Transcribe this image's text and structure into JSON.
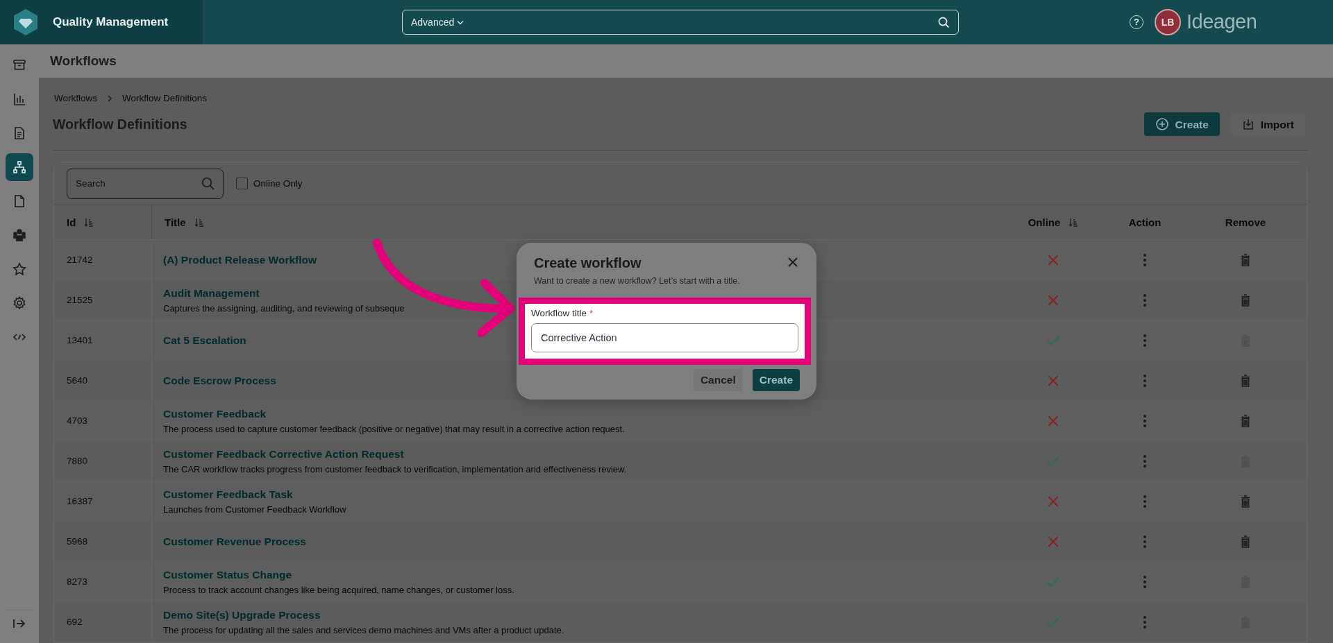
{
  "header": {
    "brand": "Quality Management",
    "search": {
      "scope": "Advanced"
    },
    "help": "?",
    "avatar": "LB",
    "logo": "Ideagen"
  },
  "sidebar": {
    "items": [
      {
        "selected": false
      },
      {
        "selected": false
      },
      {
        "selected": false
      },
      {
        "selected": true
      },
      {
        "selected": false
      },
      {
        "selected": false
      },
      {
        "selected": false
      },
      {
        "selected": false
      },
      {
        "selected": false
      }
    ]
  },
  "module_title": "Workflows",
  "breadcrumb": [
    "Workflows",
    "Workflow Definitions"
  ],
  "page_title": "Workflow Definitions",
  "actions": [
    {
      "label": "Create",
      "kind": "primary"
    },
    {
      "label": "Import",
      "kind": "secondary"
    }
  ],
  "filters": {
    "search": {
      "placeholder": "Search"
    },
    "online_only": {
      "label": "Online Only",
      "checked": false
    }
  },
  "table": {
    "columns": [
      {
        "label": "Id",
        "sortable": true
      },
      {
        "label": "Title",
        "sortable": true
      },
      {
        "label": "Online",
        "sortable": true
      },
      {
        "label": "Action",
        "sortable": false
      },
      {
        "label": "Remove",
        "sortable": false
      }
    ],
    "rows": [
      {
        "id": "21742",
        "title": "(A) Product Release Workflow",
        "online": false,
        "remove_disabled": false
      },
      {
        "id": "21525",
        "title": "Audit Management",
        "description": "Captures the assigning, auditing, and reviewing of subseque",
        "online": false,
        "remove_disabled": false
      },
      {
        "id": "13401",
        "title": "Cat 5 Escalation",
        "online": true,
        "remove_disabled": true
      },
      {
        "id": "5640",
        "title": "Code Escrow Process",
        "online": false,
        "remove_disabled": false
      },
      {
        "id": "4703",
        "title": "Customer Feedback",
        "description": "The process used to capture customer feedback (positive or negative) that may result in a corrective action request.",
        "online": false,
        "remove_disabled": false
      },
      {
        "id": "7880",
        "title": "Customer Feedback Corrective Action Request",
        "description": "The CAR workflow tracks progress from customer feedback to verification, implementation and effectiveness review.",
        "online": true,
        "remove_disabled": true
      },
      {
        "id": "16387",
        "title": "Customer Feedback Task",
        "description": "Launches from Customer Feedback Workflow",
        "online": false,
        "remove_disabled": false
      },
      {
        "id": "5968",
        "title": "Customer Revenue Process",
        "online": false,
        "remove_disabled": false
      },
      {
        "id": "8273",
        "title": "Customer Status Change",
        "description": "Process to track account changes like being acquired, name changes, or customer loss.",
        "online": true,
        "remove_disabled": true
      },
      {
        "id": "692",
        "title": "Demo Site(s) Upgrade Process",
        "description": "The process for updating all the sales and services demo machines and VMs after a product update.",
        "online": true,
        "remove_disabled": true
      }
    ]
  },
  "modal": {
    "title": "Create workflow",
    "subtitle": "Want to create a new workflow? Let’s start with a title.",
    "field": {
      "label": "Workflow title",
      "required": true,
      "required_mark": "*",
      "value": "Corrective Action"
    },
    "buttons": [
      {
        "label": "Cancel",
        "kind": "secondary"
      },
      {
        "label": "Create",
        "kind": "primary"
      }
    ]
  }
}
